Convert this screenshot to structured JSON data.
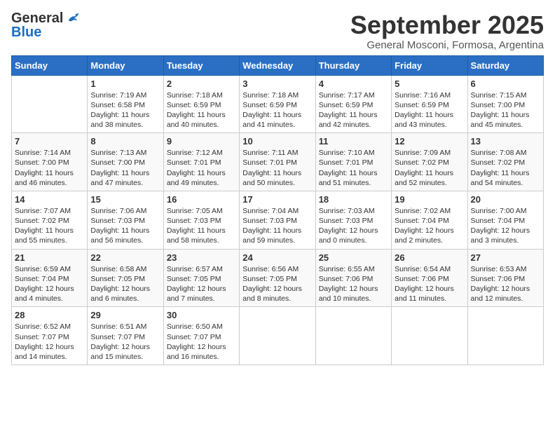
{
  "header": {
    "logo_general": "General",
    "logo_blue": "Blue",
    "month_title": "September 2025",
    "subtitle": "General Mosconi, Formosa, Argentina"
  },
  "calendar": {
    "days_of_week": [
      "Sunday",
      "Monday",
      "Tuesday",
      "Wednesday",
      "Thursday",
      "Friday",
      "Saturday"
    ],
    "weeks": [
      [
        {
          "day": "",
          "info": ""
        },
        {
          "day": "1",
          "info": "Sunrise: 7:19 AM\nSunset: 6:58 PM\nDaylight: 11 hours\nand 38 minutes."
        },
        {
          "day": "2",
          "info": "Sunrise: 7:18 AM\nSunset: 6:59 PM\nDaylight: 11 hours\nand 40 minutes."
        },
        {
          "day": "3",
          "info": "Sunrise: 7:18 AM\nSunset: 6:59 PM\nDaylight: 11 hours\nand 41 minutes."
        },
        {
          "day": "4",
          "info": "Sunrise: 7:17 AM\nSunset: 6:59 PM\nDaylight: 11 hours\nand 42 minutes."
        },
        {
          "day": "5",
          "info": "Sunrise: 7:16 AM\nSunset: 6:59 PM\nDaylight: 11 hours\nand 43 minutes."
        },
        {
          "day": "6",
          "info": "Sunrise: 7:15 AM\nSunset: 7:00 PM\nDaylight: 11 hours\nand 45 minutes."
        }
      ],
      [
        {
          "day": "7",
          "info": "Sunrise: 7:14 AM\nSunset: 7:00 PM\nDaylight: 11 hours\nand 46 minutes."
        },
        {
          "day": "8",
          "info": "Sunrise: 7:13 AM\nSunset: 7:00 PM\nDaylight: 11 hours\nand 47 minutes."
        },
        {
          "day": "9",
          "info": "Sunrise: 7:12 AM\nSunset: 7:01 PM\nDaylight: 11 hours\nand 49 minutes."
        },
        {
          "day": "10",
          "info": "Sunrise: 7:11 AM\nSunset: 7:01 PM\nDaylight: 11 hours\nand 50 minutes."
        },
        {
          "day": "11",
          "info": "Sunrise: 7:10 AM\nSunset: 7:01 PM\nDaylight: 11 hours\nand 51 minutes."
        },
        {
          "day": "12",
          "info": "Sunrise: 7:09 AM\nSunset: 7:02 PM\nDaylight: 11 hours\nand 52 minutes."
        },
        {
          "day": "13",
          "info": "Sunrise: 7:08 AM\nSunset: 7:02 PM\nDaylight: 11 hours\nand 54 minutes."
        }
      ],
      [
        {
          "day": "14",
          "info": "Sunrise: 7:07 AM\nSunset: 7:02 PM\nDaylight: 11 hours\nand 55 minutes."
        },
        {
          "day": "15",
          "info": "Sunrise: 7:06 AM\nSunset: 7:03 PM\nDaylight: 11 hours\nand 56 minutes."
        },
        {
          "day": "16",
          "info": "Sunrise: 7:05 AM\nSunset: 7:03 PM\nDaylight: 11 hours\nand 58 minutes."
        },
        {
          "day": "17",
          "info": "Sunrise: 7:04 AM\nSunset: 7:03 PM\nDaylight: 11 hours\nand 59 minutes."
        },
        {
          "day": "18",
          "info": "Sunrise: 7:03 AM\nSunset: 7:03 PM\nDaylight: 12 hours\nand 0 minutes."
        },
        {
          "day": "19",
          "info": "Sunrise: 7:02 AM\nSunset: 7:04 PM\nDaylight: 12 hours\nand 2 minutes."
        },
        {
          "day": "20",
          "info": "Sunrise: 7:00 AM\nSunset: 7:04 PM\nDaylight: 12 hours\nand 3 minutes."
        }
      ],
      [
        {
          "day": "21",
          "info": "Sunrise: 6:59 AM\nSunset: 7:04 PM\nDaylight: 12 hours\nand 4 minutes."
        },
        {
          "day": "22",
          "info": "Sunrise: 6:58 AM\nSunset: 7:05 PM\nDaylight: 12 hours\nand 6 minutes."
        },
        {
          "day": "23",
          "info": "Sunrise: 6:57 AM\nSunset: 7:05 PM\nDaylight: 12 hours\nand 7 minutes."
        },
        {
          "day": "24",
          "info": "Sunrise: 6:56 AM\nSunset: 7:05 PM\nDaylight: 12 hours\nand 8 minutes."
        },
        {
          "day": "25",
          "info": "Sunrise: 6:55 AM\nSunset: 7:06 PM\nDaylight: 12 hours\nand 10 minutes."
        },
        {
          "day": "26",
          "info": "Sunrise: 6:54 AM\nSunset: 7:06 PM\nDaylight: 12 hours\nand 11 minutes."
        },
        {
          "day": "27",
          "info": "Sunrise: 6:53 AM\nSunset: 7:06 PM\nDaylight: 12 hours\nand 12 minutes."
        }
      ],
      [
        {
          "day": "28",
          "info": "Sunrise: 6:52 AM\nSunset: 7:07 PM\nDaylight: 12 hours\nand 14 minutes."
        },
        {
          "day": "29",
          "info": "Sunrise: 6:51 AM\nSunset: 7:07 PM\nDaylight: 12 hours\nand 15 minutes."
        },
        {
          "day": "30",
          "info": "Sunrise: 6:50 AM\nSunset: 7:07 PM\nDaylight: 12 hours\nand 16 minutes."
        },
        {
          "day": "",
          "info": ""
        },
        {
          "day": "",
          "info": ""
        },
        {
          "day": "",
          "info": ""
        },
        {
          "day": "",
          "info": ""
        }
      ]
    ]
  }
}
